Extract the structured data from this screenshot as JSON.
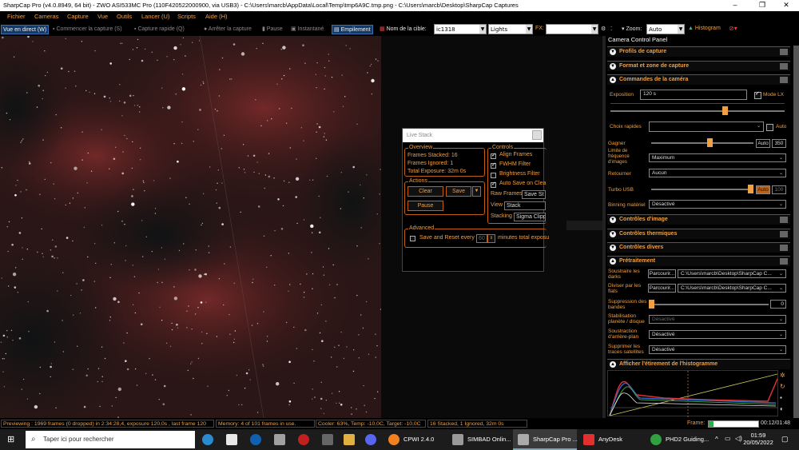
{
  "window": {
    "title": "SharpCap Pro (v4.0.8949, 64 bit) - ZWO ASI533MC Pro (110F420522000900, via USB3) - C:\\Users\\marcb\\AppData\\Local\\Temp\\tmp6A9C.tmp.png - C:\\Users\\marcb\\Desktop\\SharpCap Captures"
  },
  "menu": [
    "Fichier",
    "Cameras",
    "Capture",
    "Vue",
    "Outils",
    "Lancer (U)",
    "Scripts",
    "Aide (H)"
  ],
  "toolbar": {
    "live_view": "Vue en direct (W)",
    "start_capture": "Commencer la capture (S)",
    "quick_capture": "Capture rapide (Q)",
    "stop_capture": "Arrêter la capture",
    "pause": "Pause",
    "snapshot": "Instantané",
    "stacking": "Empilement",
    "target_label": "Nom de la cible:",
    "target_value": "ic1318",
    "frame_type": "Lights",
    "fx_label": "FX:",
    "fx_value": "",
    "zoom_label": "Zoom:",
    "zoom_value": "Auto",
    "histogram": "Histogram"
  },
  "live_stack": {
    "title": "Live Stack",
    "overview_title": "Overview",
    "frames_stacked_label": "Frames Stacked:",
    "frames_stacked": "16",
    "frames_ignored_label": "Frames Ignored:",
    "frames_ignored": "1",
    "total_exposure_label": "Total Exposure:",
    "total_exposure": "32m 0s",
    "actions_title": "Actions",
    "clear": "Clear",
    "save": "Save",
    "pause": "Pause",
    "controls_title": "Controls",
    "align_frames": "Align Frames",
    "fwhm_filter": "FWHM Filter",
    "brightness_filter": "Brightness Filter",
    "auto_save": "Auto Save on Clea",
    "raw_frames_label": "Raw Frames",
    "raw_frames_value": "Save St",
    "view_label": "View",
    "view_value": "Stack",
    "stacking_label": "Stacking",
    "stacking_value": "Sigma Clipp",
    "advanced_title": "Advanced",
    "save_reset_every": "Save and Reset every",
    "save_reset_value": "60",
    "minutes_total": "minutes total exposu"
  },
  "panel": {
    "title": "Camera Control Panel",
    "sections": {
      "capture_profiles": "Profils de capture",
      "format_area": "Format et zone de capture",
      "camera_controls": "Commandes de la caméra",
      "image_controls": "Contrôles d'image",
      "thermal_controls": "Contrôles thermiques",
      "misc_controls": "Contrôles divers",
      "preprocessing": "Prétraitement",
      "histogram_stretch": "Afficher l'étirement de l'histogramme"
    },
    "exposure_label": "Exposition",
    "exposure_value": "120 s",
    "lx_mode": "Mode LX",
    "quick_choices": "Choix rapides",
    "quick_choices_auto": "Auto",
    "gain_label": "Gagner",
    "gain_auto": "Auto",
    "gain_value": "350",
    "gain_level": 0.42,
    "fps_limit_label": "Limite de fréquence d'images",
    "fps_limit_value": "Maximum",
    "flip_label": "Retourner",
    "flip_value": "Aucun",
    "turbo_label": "Turbo USB",
    "turbo_auto": "Auto",
    "turbo_value": "100",
    "turbo_level": 1.0,
    "binning_label": "Binning matériel",
    "binning_value": "Désactivé",
    "darks_label": "Soustraire les darks",
    "darks_browse": "Parcourir...",
    "darks_path": "C:\\Users\\marcb\\Desktop\\SharpCap C...",
    "flats_label": "Diviser par les flats",
    "flats_browse": "Parcourir...",
    "flats_path": "C:\\Users\\marcb\\Desktop\\SharpCap C...",
    "banding_label": "Suppression des bandes",
    "banding_value": "0",
    "stabilization_label": "Stabilisation planète / disque",
    "stabilization_value": "Désactivé",
    "bg_subtraction_label": "Soustraction d'arrière-plan",
    "bg_subtraction_value": "Désactivé",
    "satellite_label": "Supprimer les traces satellites",
    "satellite_value": "Désactivé",
    "frame_label": "Frame:",
    "frame_time": "00:12/01:48"
  },
  "status": {
    "preview": "Previewing : 1969 frames (0 dropped) in 2:34:28,4, exposure 120,0s , last frame 120",
    "memory": "Memory: 4 of 101 frames in use.",
    "cooler": "Cooler: 63%, Temp: -10,0C, Target: -10,0C",
    "stack": "16 Stacked, 1 Ignored, 32m 0s"
  },
  "taskbar": {
    "search_placeholder": "Taper ici pour rechercher",
    "apps": [
      "CPWI 2.4.0",
      "SIMBAD Onlin...",
      "SharpCap Pro ...",
      "AnyDesk",
      "PHD2 Guiding..."
    ],
    "time": "01:59",
    "date": "20/05/2022"
  },
  "colors": {
    "accent": "#f0a040",
    "group_border": "#c06010",
    "nebula": "#5a2020",
    "active_button": "#163a66"
  }
}
